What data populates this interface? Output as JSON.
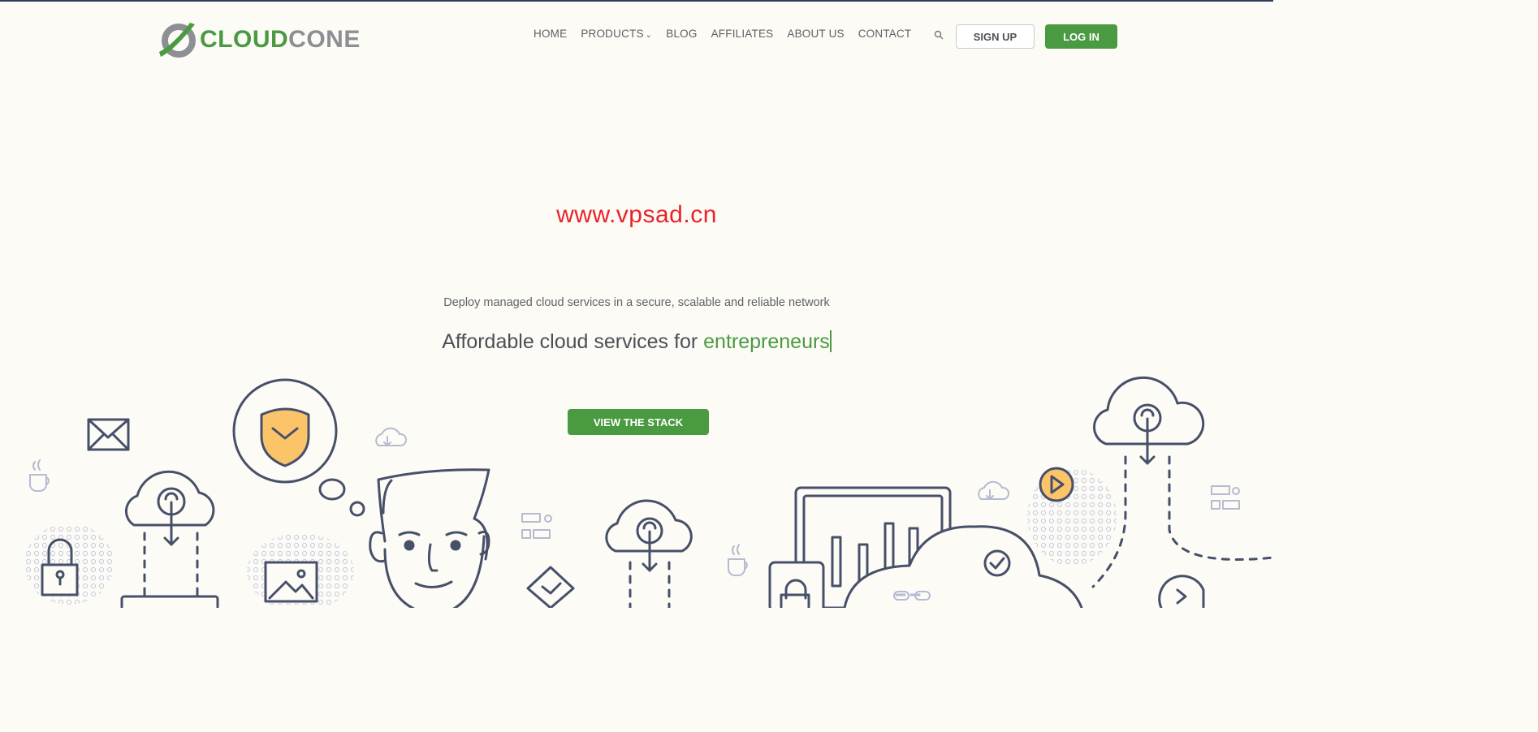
{
  "brand": {
    "part1": "CLOUD",
    "part2": "CONE",
    "logo_icon": "cloudcone-logo-icon"
  },
  "nav": {
    "items": [
      {
        "label": "HOME"
      },
      {
        "label": "PRODUCTS",
        "icon": "chevron-down-icon"
      },
      {
        "label": "BLOG"
      },
      {
        "label": "AFFILIATES"
      },
      {
        "label": "ABOUT US"
      },
      {
        "label": "CONTACT"
      }
    ],
    "search_icon": "search-icon",
    "signup_label": "SIGN UP",
    "login_label": "LOG IN"
  },
  "hero": {
    "watermark": "www.vpsad.cn",
    "subtitle": "Deploy managed cloud services in a secure, scalable and reliable network",
    "headline_prefix": "Affordable cloud services for ",
    "headline_highlight": "entrepreneurs",
    "cta_label": "VIEW THE STACK"
  },
  "colors": {
    "brand_green": "#4a9a41",
    "logo_gray": "#8c8f93",
    "background": "#fdfbf6",
    "watermark_red": "#e8232b",
    "illustration_stroke": "#475069",
    "illustration_accent": "#fcc469"
  }
}
